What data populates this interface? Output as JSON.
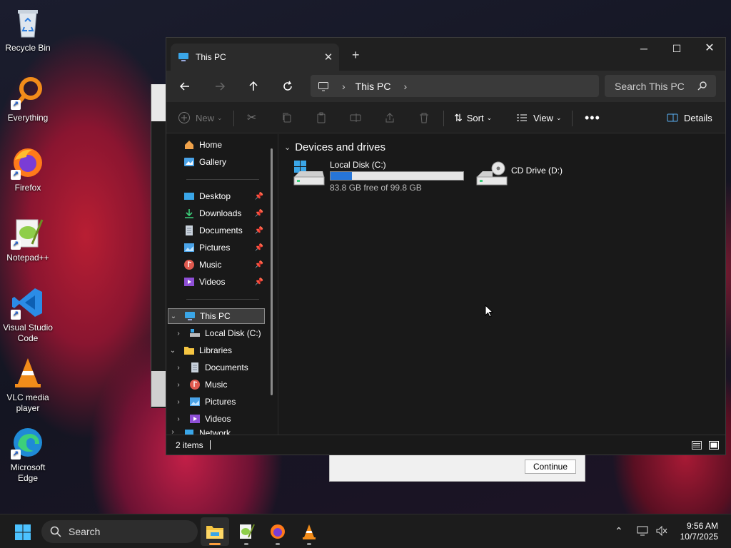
{
  "desktop": {
    "icons": [
      {
        "label": "Recycle Bin"
      },
      {
        "label": "Everything"
      },
      {
        "label": "Firefox"
      },
      {
        "label": "Notepad++"
      },
      {
        "label": "Visual Studio Code"
      },
      {
        "label": "VLC media player"
      },
      {
        "label": "Microsoft Edge"
      }
    ]
  },
  "background_dialog": {
    "continue_label": "Continue"
  },
  "window": {
    "tab_title": "This PC",
    "address": {
      "crumb": "This PC"
    },
    "search_placeholder": "Search This PC",
    "toolbar": {
      "new_label": "New",
      "sort_label": "Sort",
      "view_label": "View",
      "details_label": "Details"
    },
    "nav": {
      "home": "Home",
      "gallery": "Gallery",
      "quick": [
        "Desktop",
        "Downloads",
        "Documents",
        "Pictures",
        "Music",
        "Videos"
      ],
      "this_pc": "This PC",
      "local_disk": "Local Disk (C:)",
      "libraries": "Libraries",
      "lib_items": [
        "Documents",
        "Music",
        "Pictures",
        "Videos"
      ],
      "network": "Network"
    },
    "content": {
      "group_title": "Devices and drives",
      "drives": [
        {
          "name": "Local Disk (C:)",
          "free_text": "83.8 GB free of 99.8 GB",
          "used_fraction": 0.16
        },
        {
          "name": "CD Drive (D:)"
        }
      ]
    },
    "status": {
      "items_count": "2 items"
    }
  },
  "taskbar": {
    "search_label": "Search",
    "clock": {
      "time": "9:56 AM",
      "date": "10/7/2025"
    }
  },
  "colors": {
    "accent": "#2675d8",
    "folder": "#f5c542",
    "active_indicator": "#ff9e3d"
  }
}
